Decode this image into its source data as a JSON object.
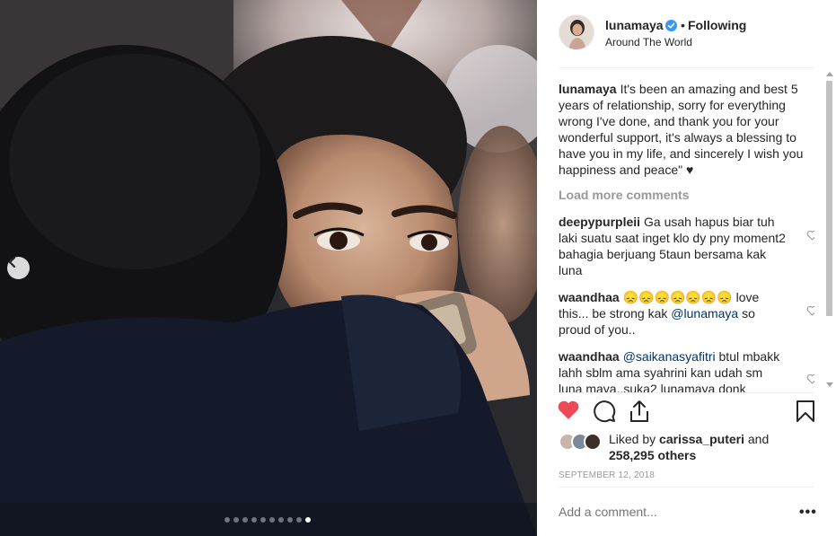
{
  "post": {
    "username": "lunamaya",
    "dot": "•",
    "follow_status": "Following",
    "location": "Around The World",
    "caption_user": "lunamaya",
    "caption_text": "It's been an amazing and best 5 years of relationship, sorry for everything wrong I've done, and thank you for your wonderful support, it's always a blessing to have you in my life, and sincerely I wish you happiness and peace\" ♥",
    "load_more": "Load more comments",
    "comments": [
      {
        "user": "deepypurpleii",
        "text": "Ga usah hapus biar tuh laki suatu saat inget klo dy pny moment2 bahagia berjuang 5taun bersama kak luna"
      },
      {
        "user": "waandhaa",
        "emoji": "😞😞😞😞😞😞😞",
        "text_before": " love this... be strong kak ",
        "mention": "@lunamaya",
        "text_after": " so proud of you.."
      },
      {
        "user": "waandhaa",
        "mention": "@saikanasyafitri",
        "text_after": " btul mbakk lahh sblm ama syahrini kan udah sm luna maya..suka2 lunamaya donk mw.hapus atw gak..ihhhh sewot ajaaa"
      }
    ],
    "liked_by_prefix": "Liked by",
    "liked_by_user": "carissa_puteri",
    "liked_by_and": "and",
    "liked_by_others": "258,295 others",
    "date": "SEPTEMBER 12, 2018",
    "add_comment_placeholder": "Add a comment...",
    "more_options": "•••"
  },
  "carousel": {
    "total_slides": 10,
    "active_slide": 10
  },
  "colors": {
    "like_red": "#ed4956",
    "text": "#262626",
    "muted": "#999999",
    "verified_blue": "#3897f0"
  },
  "icons": [
    "chevron-left-icon",
    "verified-badge-icon",
    "heart-filled-icon",
    "comment-icon",
    "share-icon",
    "bookmark-icon",
    "heart-outline-icon"
  ]
}
